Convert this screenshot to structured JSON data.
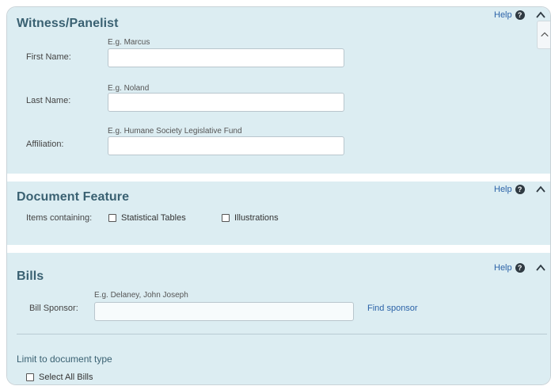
{
  "witness": {
    "title": "Witness/Panelist",
    "help": "Help",
    "fields": [
      {
        "label": "First Name:",
        "hint": "E.g. Marcus",
        "value": ""
      },
      {
        "label": "Last Name:",
        "hint": "E.g. Noland",
        "value": ""
      },
      {
        "label": "Affiliation:",
        "hint": "E.g. Humane Society Legislative Fund",
        "value": ""
      }
    ]
  },
  "document_feature": {
    "title": "Document Feature",
    "help": "Help",
    "items_label": "Items containing:",
    "options": [
      "Statistical Tables",
      "Illustrations"
    ]
  },
  "bills": {
    "title": "Bills",
    "help": "Help",
    "sponsor_label": "Bill Sponsor:",
    "sponsor_hint": "E.g. Delaney, John Joseph",
    "sponsor_value": "",
    "find_sponsor": "Find sponsor",
    "limit_heading": "Limit to document type",
    "select_all": "Select All Bills"
  },
  "icons": {
    "help": "question-circle-icon",
    "collapse": "chevron-up-icon"
  },
  "colors": {
    "panel_bg": "#dcedf2",
    "heading": "#3a6172",
    "link": "#2c63a8"
  }
}
